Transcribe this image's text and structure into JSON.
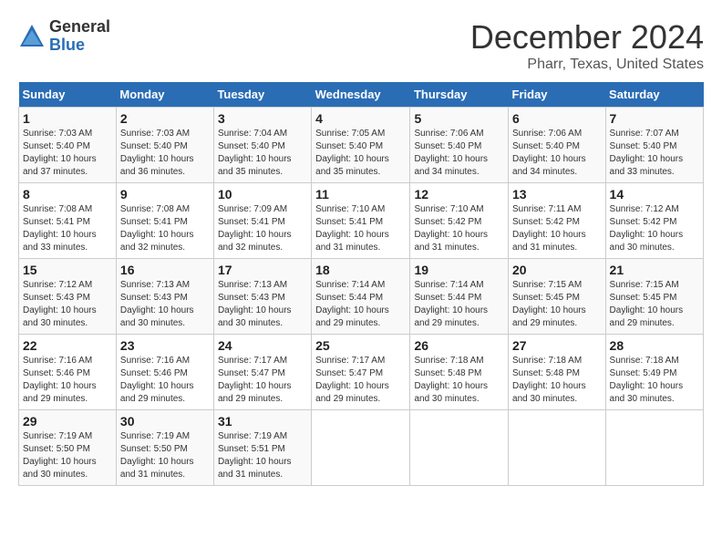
{
  "header": {
    "logo_general": "General",
    "logo_blue": "Blue",
    "month_title": "December 2024",
    "location": "Pharr, Texas, United States"
  },
  "weekdays": [
    "Sunday",
    "Monday",
    "Tuesday",
    "Wednesday",
    "Thursday",
    "Friday",
    "Saturday"
  ],
  "weeks": [
    [
      {
        "day": "1",
        "sunrise": "7:03 AM",
        "sunset": "5:40 PM",
        "daylight": "10 hours and 37 minutes."
      },
      {
        "day": "2",
        "sunrise": "7:03 AM",
        "sunset": "5:40 PM",
        "daylight": "10 hours and 36 minutes."
      },
      {
        "day": "3",
        "sunrise": "7:04 AM",
        "sunset": "5:40 PM",
        "daylight": "10 hours and 35 minutes."
      },
      {
        "day": "4",
        "sunrise": "7:05 AM",
        "sunset": "5:40 PM",
        "daylight": "10 hours and 35 minutes."
      },
      {
        "day": "5",
        "sunrise": "7:06 AM",
        "sunset": "5:40 PM",
        "daylight": "10 hours and 34 minutes."
      },
      {
        "day": "6",
        "sunrise": "7:06 AM",
        "sunset": "5:40 PM",
        "daylight": "10 hours and 34 minutes."
      },
      {
        "day": "7",
        "sunrise": "7:07 AM",
        "sunset": "5:40 PM",
        "daylight": "10 hours and 33 minutes."
      }
    ],
    [
      {
        "day": "8",
        "sunrise": "7:08 AM",
        "sunset": "5:41 PM",
        "daylight": "10 hours and 33 minutes."
      },
      {
        "day": "9",
        "sunrise": "7:08 AM",
        "sunset": "5:41 PM",
        "daylight": "10 hours and 32 minutes."
      },
      {
        "day": "10",
        "sunrise": "7:09 AM",
        "sunset": "5:41 PM",
        "daylight": "10 hours and 32 minutes."
      },
      {
        "day": "11",
        "sunrise": "7:10 AM",
        "sunset": "5:41 PM",
        "daylight": "10 hours and 31 minutes."
      },
      {
        "day": "12",
        "sunrise": "7:10 AM",
        "sunset": "5:42 PM",
        "daylight": "10 hours and 31 minutes."
      },
      {
        "day": "13",
        "sunrise": "7:11 AM",
        "sunset": "5:42 PM",
        "daylight": "10 hours and 31 minutes."
      },
      {
        "day": "14",
        "sunrise": "7:12 AM",
        "sunset": "5:42 PM",
        "daylight": "10 hours and 30 minutes."
      }
    ],
    [
      {
        "day": "15",
        "sunrise": "7:12 AM",
        "sunset": "5:43 PM",
        "daylight": "10 hours and 30 minutes."
      },
      {
        "day": "16",
        "sunrise": "7:13 AM",
        "sunset": "5:43 PM",
        "daylight": "10 hours and 30 minutes."
      },
      {
        "day": "17",
        "sunrise": "7:13 AM",
        "sunset": "5:43 PM",
        "daylight": "10 hours and 30 minutes."
      },
      {
        "day": "18",
        "sunrise": "7:14 AM",
        "sunset": "5:44 PM",
        "daylight": "10 hours and 29 minutes."
      },
      {
        "day": "19",
        "sunrise": "7:14 AM",
        "sunset": "5:44 PM",
        "daylight": "10 hours and 29 minutes."
      },
      {
        "day": "20",
        "sunrise": "7:15 AM",
        "sunset": "5:45 PM",
        "daylight": "10 hours and 29 minutes."
      },
      {
        "day": "21",
        "sunrise": "7:15 AM",
        "sunset": "5:45 PM",
        "daylight": "10 hours and 29 minutes."
      }
    ],
    [
      {
        "day": "22",
        "sunrise": "7:16 AM",
        "sunset": "5:46 PM",
        "daylight": "10 hours and 29 minutes."
      },
      {
        "day": "23",
        "sunrise": "7:16 AM",
        "sunset": "5:46 PM",
        "daylight": "10 hours and 29 minutes."
      },
      {
        "day": "24",
        "sunrise": "7:17 AM",
        "sunset": "5:47 PM",
        "daylight": "10 hours and 29 minutes."
      },
      {
        "day": "25",
        "sunrise": "7:17 AM",
        "sunset": "5:47 PM",
        "daylight": "10 hours and 29 minutes."
      },
      {
        "day": "26",
        "sunrise": "7:18 AM",
        "sunset": "5:48 PM",
        "daylight": "10 hours and 30 minutes."
      },
      {
        "day": "27",
        "sunrise": "7:18 AM",
        "sunset": "5:48 PM",
        "daylight": "10 hours and 30 minutes."
      },
      {
        "day": "28",
        "sunrise": "7:18 AM",
        "sunset": "5:49 PM",
        "daylight": "10 hours and 30 minutes."
      }
    ],
    [
      {
        "day": "29",
        "sunrise": "7:19 AM",
        "sunset": "5:50 PM",
        "daylight": "10 hours and 30 minutes."
      },
      {
        "day": "30",
        "sunrise": "7:19 AM",
        "sunset": "5:50 PM",
        "daylight": "10 hours and 31 minutes."
      },
      {
        "day": "31",
        "sunrise": "7:19 AM",
        "sunset": "5:51 PM",
        "daylight": "10 hours and 31 minutes."
      },
      null,
      null,
      null,
      null
    ]
  ]
}
